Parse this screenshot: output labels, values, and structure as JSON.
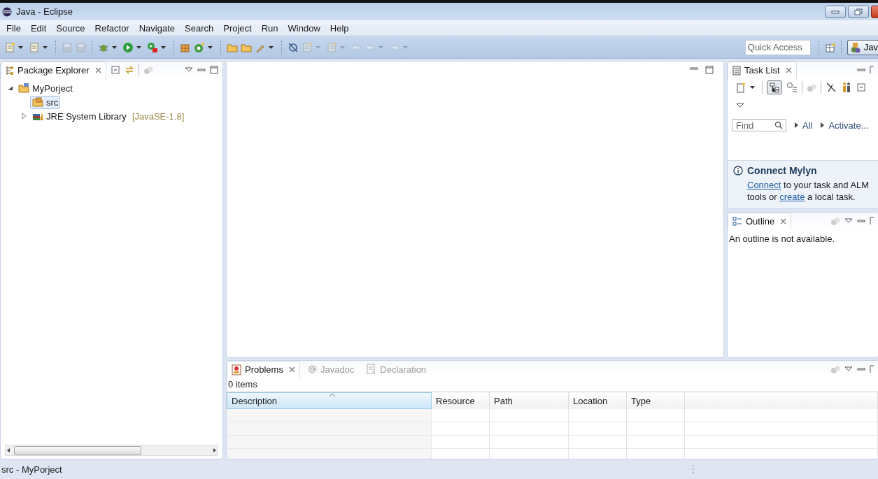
{
  "window": {
    "title": "Java - Eclipse"
  },
  "menu": [
    "File",
    "Edit",
    "Source",
    "Refactor",
    "Navigate",
    "Search",
    "Project",
    "Run",
    "Window",
    "Help"
  ],
  "toolbar": {
    "quick_access": {
      "placeholder": "Quick Access"
    },
    "perspective": {
      "label": "Jav",
      "selected": true
    }
  },
  "package_explorer": {
    "title": "Package Explorer",
    "tree": [
      {
        "label": "MyPorject",
        "kind": "project",
        "expanded": true,
        "selected": false,
        "children": [
          {
            "label": "src",
            "kind": "source",
            "selected": true
          },
          {
            "label": "JRE System Library",
            "kind": "library",
            "decoration": "[JavaSE-1.8]",
            "expanded": false,
            "selected": false
          }
        ]
      }
    ]
  },
  "task_list": {
    "title": "Task List",
    "find": {
      "placeholder": "Find"
    },
    "filters": [
      "All",
      "Activate..."
    ],
    "connect": {
      "title": "Connect Mylyn",
      "parts": [
        {
          "text": "Connect",
          "link": true
        },
        {
          "text": " to your task and ALM tools or ",
          "link": false
        },
        {
          "text": "create",
          "link": true
        },
        {
          "text": " a local task.",
          "link": false
        }
      ]
    }
  },
  "outline": {
    "title": "Outline",
    "message": "An outline is not available."
  },
  "bottom_panel": {
    "tabs": [
      {
        "label": "Problems",
        "selected": true
      },
      {
        "label": "Javadoc",
        "selected": false
      },
      {
        "label": "Declaration",
        "selected": false
      }
    ],
    "count": "0 items",
    "columns": [
      "Description",
      "Resource",
      "Path",
      "Location",
      "Type"
    ]
  },
  "status_bar": "src - MyPorject"
}
